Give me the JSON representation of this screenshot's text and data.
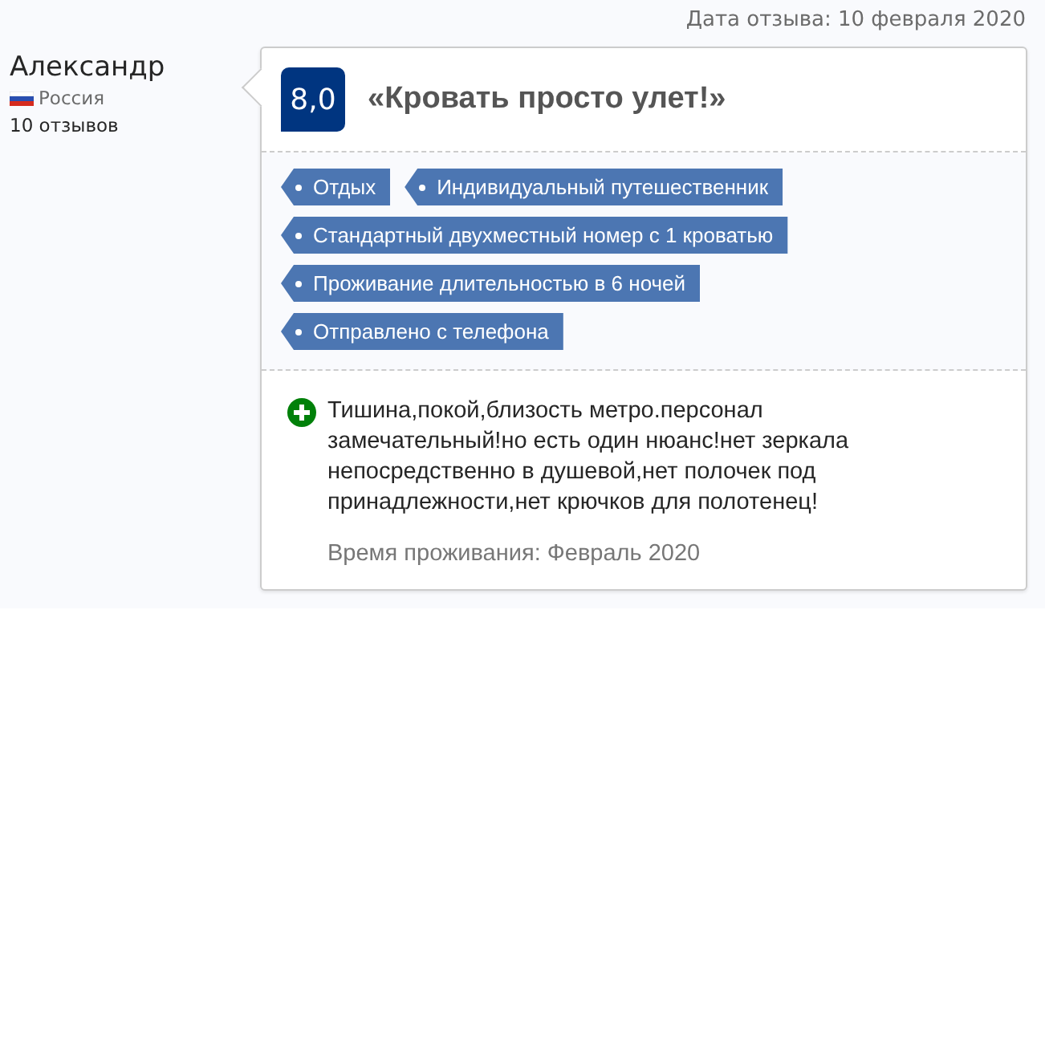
{
  "review_date": "Дата отзыва: 10 февраля 2020",
  "reviewer": {
    "name": "Александр",
    "country": "Россия",
    "review_count": "10 отзывов"
  },
  "review": {
    "score": "8,0",
    "title": "«Кровать просто улет!»",
    "tag_rows": [
      [
        "Отдых",
        "Индивидуальный путешественник"
      ],
      [
        "Стандартный двухместный номер с 1 кроватью"
      ],
      [
        "Проживание длительностью в 6 ночей"
      ],
      [
        "Отправлено с телефона"
      ]
    ],
    "positive": "Тишина,покой,близость метро.персонал замечательный!но есть один нюанс!нет зеркала непосредственно в душевой,нет полочек под принадлежности,нет крючков для полотенец!",
    "stay_date": "Время проживания: Февраль 2020"
  }
}
